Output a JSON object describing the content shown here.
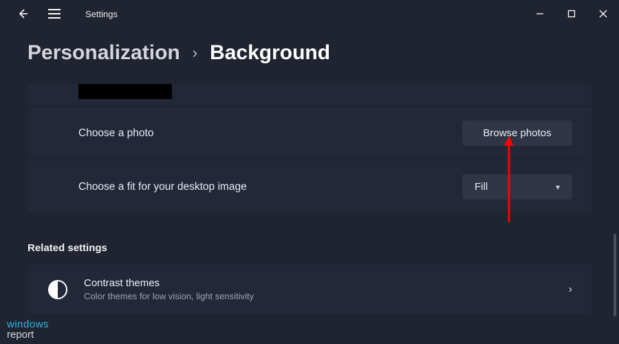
{
  "window": {
    "app_title": "Settings"
  },
  "breadcrumb": {
    "parent": "Personalization",
    "current": "Background"
  },
  "rows": {
    "choose_photo": {
      "label": "Choose a photo",
      "button": "Browse photos"
    },
    "choose_fit": {
      "label": "Choose a fit for your desktop image",
      "selected": "Fill"
    }
  },
  "related": {
    "heading": "Related settings",
    "contrast": {
      "title": "Contrast themes",
      "description": "Color themes for low vision, light sensitivity"
    }
  },
  "watermark": {
    "line1": "windows",
    "line2": "report"
  },
  "colors": {
    "accent_arrow": "#ff0000"
  }
}
